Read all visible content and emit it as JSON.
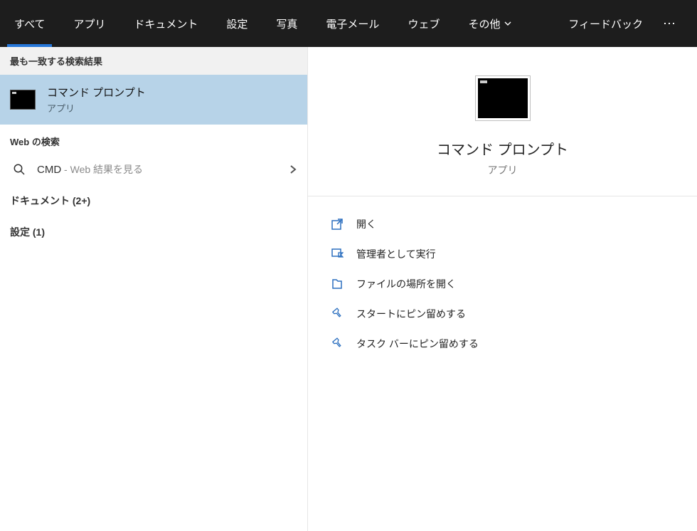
{
  "topbar": {
    "tabs": [
      {
        "label": "すべて",
        "active": true
      },
      {
        "label": "アプリ"
      },
      {
        "label": "ドキュメント"
      },
      {
        "label": "設定"
      },
      {
        "label": "写真"
      },
      {
        "label": "電子メール"
      },
      {
        "label": "ウェブ"
      },
      {
        "label": "その他",
        "dropdown": true
      }
    ],
    "feedback": "フィードバック",
    "more": "⋯"
  },
  "left": {
    "best_match_header": "最も一致する検索結果",
    "best_match": {
      "title": "コマンド プロンプト",
      "subtitle": "アプリ"
    },
    "web_header": "Web の検索",
    "web_item": {
      "query": "CMD",
      "secondary": " - Web 結果を見る"
    },
    "cat_documents": "ドキュメント (2+)",
    "cat_settings": "設定 (1)"
  },
  "right": {
    "title": "コマンド プロンプト",
    "subtitle": "アプリ",
    "actions": [
      {
        "icon": "open",
        "label": "開く"
      },
      {
        "icon": "admin",
        "label": "管理者として実行"
      },
      {
        "icon": "folder",
        "label": "ファイルの場所を開く"
      },
      {
        "icon": "pin",
        "label": "スタートにピン留めする"
      },
      {
        "icon": "pin",
        "label": "タスク バーにピン留めする"
      }
    ]
  }
}
